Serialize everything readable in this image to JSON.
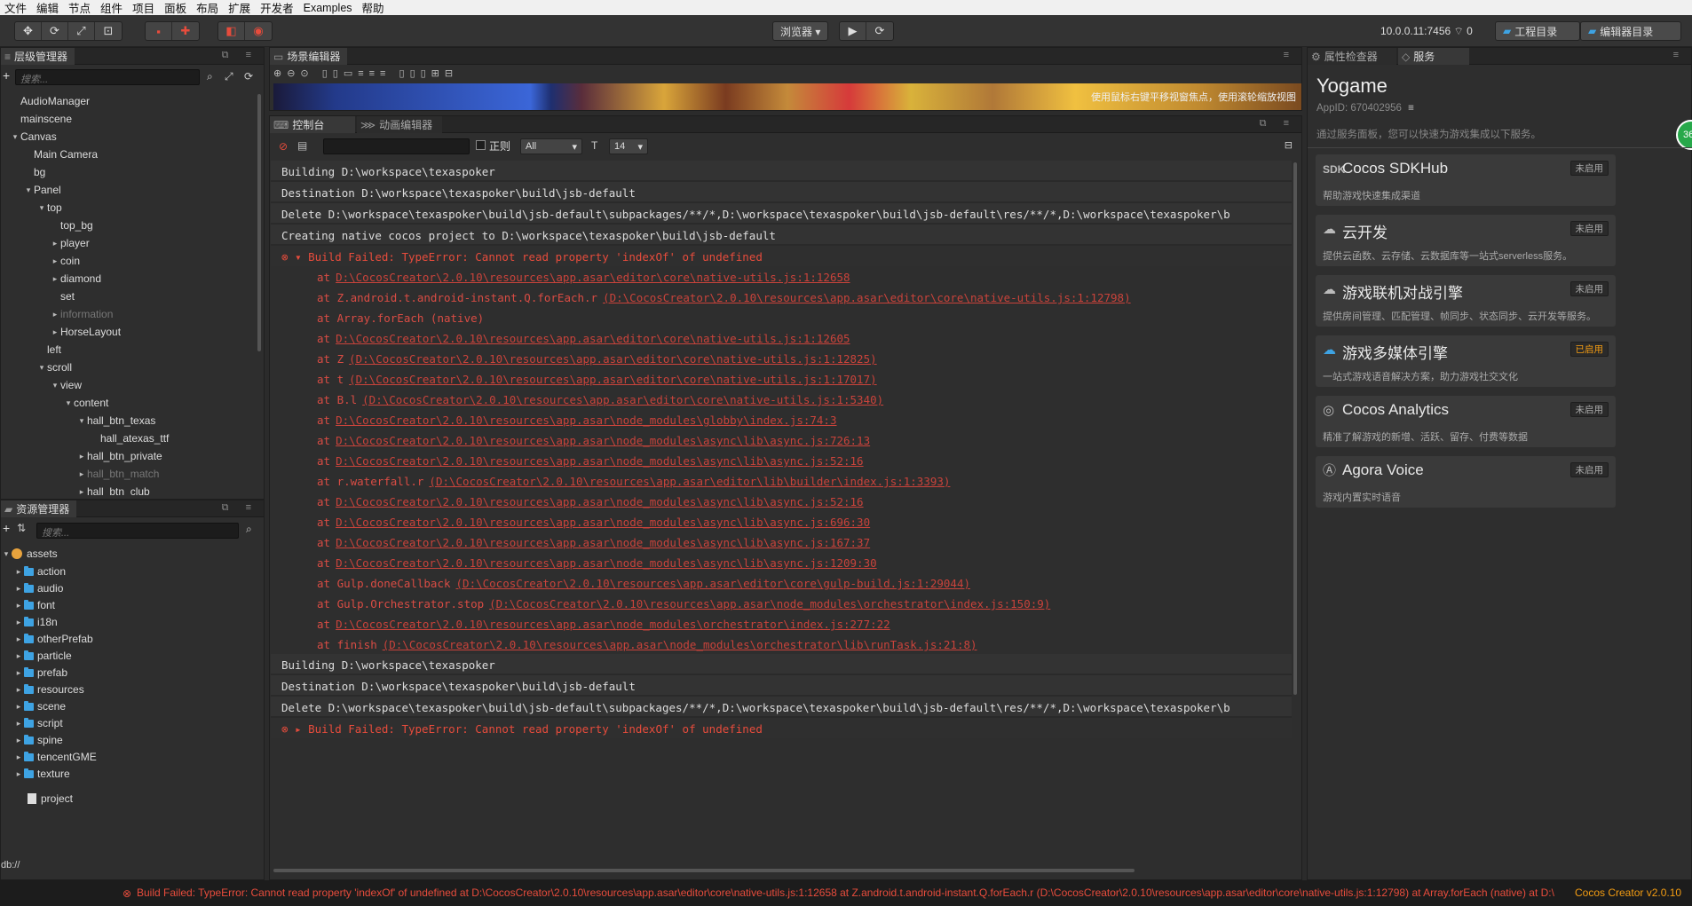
{
  "menubar": {
    "items": [
      "文件",
      "编辑",
      "节点",
      "组件",
      "项目",
      "面板",
      "布局",
      "扩展",
      "开发者",
      "Examples",
      "帮助"
    ]
  },
  "toolbar": {
    "browser_label": "浏览器 ▾",
    "ip": "10.0.0.11:7456",
    "conn_count": "0",
    "project_dir": "工程目录",
    "editor_dir": "编辑器目录"
  },
  "hierarchy": {
    "tab": "层级管理器",
    "search_placeholder": "搜索...",
    "nodes": [
      {
        "label": "AudioManager",
        "indent": 0,
        "arrow": ""
      },
      {
        "label": "mainscene",
        "indent": 0,
        "arrow": ""
      },
      {
        "label": "Canvas",
        "indent": 0,
        "arrow": "▾"
      },
      {
        "label": "Main Camera",
        "indent": 1,
        "arrow": ""
      },
      {
        "label": "bg",
        "indent": 1,
        "arrow": ""
      },
      {
        "label": "Panel",
        "indent": 1,
        "arrow": "▾"
      },
      {
        "label": "top",
        "indent": 2,
        "arrow": "▾"
      },
      {
        "label": "top_bg",
        "indent": 3,
        "arrow": ""
      },
      {
        "label": "player",
        "indent": 3,
        "arrow": "▸"
      },
      {
        "label": "coin",
        "indent": 3,
        "arrow": "▸"
      },
      {
        "label": "diamond",
        "indent": 3,
        "arrow": "▸"
      },
      {
        "label": "set",
        "indent": 3,
        "arrow": ""
      },
      {
        "label": "information",
        "indent": 3,
        "arrow": "▸",
        "dim": true
      },
      {
        "label": "HorseLayout",
        "indent": 3,
        "arrow": "▸"
      },
      {
        "label": "left",
        "indent": 2,
        "arrow": ""
      },
      {
        "label": "scroll",
        "indent": 2,
        "arrow": "▾"
      },
      {
        "label": "view",
        "indent": 3,
        "arrow": "▾"
      },
      {
        "label": "content",
        "indent": 4,
        "arrow": "▾"
      },
      {
        "label": "hall_btn_texas",
        "indent": 5,
        "arrow": "▾"
      },
      {
        "label": "hall_atexas_ttf",
        "indent": 6,
        "arrow": ""
      },
      {
        "label": "hall_btn_private",
        "indent": 5,
        "arrow": "▸"
      },
      {
        "label": "hall_btn_match",
        "indent": 5,
        "arrow": "▸",
        "dim": true
      },
      {
        "label": "hall_btn_club",
        "indent": 5,
        "arrow": "▸"
      }
    ]
  },
  "assets": {
    "tab": "资源管理器",
    "search_placeholder": "搜索...",
    "root": "assets",
    "folders": [
      "action",
      "audio",
      "font",
      "i18n",
      "otherPrefab",
      "particle",
      "prefab",
      "resources",
      "scene",
      "script",
      "spine",
      "tencentGME",
      "texture"
    ],
    "file": "project",
    "footer": "db://"
  },
  "scene": {
    "tab": "场景编辑器",
    "hint": "使用鼠标右键平移视窗焦点，使用滚轮缩放视图"
  },
  "console": {
    "tab_console": "控制台",
    "tab_anim": "动画编辑器",
    "regex_label": "正则",
    "filter_value": "All",
    "font_size": "14",
    "logs": [
      {
        "type": "info",
        "text": "Building D:\\workspace\\texaspoker"
      },
      {
        "type": "info",
        "text": "Destination D:\\workspace\\texaspoker\\build\\jsb-default"
      },
      {
        "type": "info",
        "text": "Delete D:\\workspace\\texaspoker\\build\\jsb-default\\subpackages/**/*,D:\\workspace\\texaspoker\\build\\jsb-default\\res/**/*,D:\\workspace\\texaspoker\\b"
      },
      {
        "type": "info",
        "text": "Creating native cocos project to D:\\workspace\\texaspoker\\build\\jsb-default"
      },
      {
        "type": "err",
        "text": "Build Failed: TypeError: Cannot read property 'indexOf' of undefined",
        "open": true
      },
      {
        "type": "trace",
        "fn": "at",
        "loc": "D:\\CocosCreator\\2.0.10\\resources\\app.asar\\editor\\core\\native-utils.js:1:12658"
      },
      {
        "type": "trace",
        "fn": "at Z.android.t.android-instant.Q.forEach.r",
        "loc": "(D:\\CocosCreator\\2.0.10\\resources\\app.asar\\editor\\core\\native-utils.js:1:12798)"
      },
      {
        "type": "trace",
        "fn": "at Array.forEach (native)",
        "loc": ""
      },
      {
        "type": "trace",
        "fn": "at",
        "loc": "D:\\CocosCreator\\2.0.10\\resources\\app.asar\\editor\\core\\native-utils.js:1:12605"
      },
      {
        "type": "trace",
        "fn": "at Z",
        "loc": "(D:\\CocosCreator\\2.0.10\\resources\\app.asar\\editor\\core\\native-utils.js:1:12825)"
      },
      {
        "type": "trace",
        "fn": "at t",
        "loc": "(D:\\CocosCreator\\2.0.10\\resources\\app.asar\\editor\\core\\native-utils.js:1:17017)"
      },
      {
        "type": "trace",
        "fn": "at B.l",
        "loc": "(D:\\CocosCreator\\2.0.10\\resources\\app.asar\\editor\\core\\native-utils.js:1:5340)"
      },
      {
        "type": "trace",
        "fn": "at",
        "loc": "D:\\CocosCreator\\2.0.10\\resources\\app.asar\\node_modules\\globby\\index.js:74:3"
      },
      {
        "type": "trace",
        "fn": "at",
        "loc": "D:\\CocosCreator\\2.0.10\\resources\\app.asar\\node_modules\\async\\lib\\async.js:726:13"
      },
      {
        "type": "trace",
        "fn": "at",
        "loc": "D:\\CocosCreator\\2.0.10\\resources\\app.asar\\node_modules\\async\\lib\\async.js:52:16"
      },
      {
        "type": "trace",
        "fn": "at r.waterfall.r",
        "loc": "(D:\\CocosCreator\\2.0.10\\resources\\app.asar\\editor\\lib\\builder\\index.js:1:3393)"
      },
      {
        "type": "trace",
        "fn": "at",
        "loc": "D:\\CocosCreator\\2.0.10\\resources\\app.asar\\node_modules\\async\\lib\\async.js:52:16"
      },
      {
        "type": "trace",
        "fn": "at",
        "loc": "D:\\CocosCreator\\2.0.10\\resources\\app.asar\\node_modules\\async\\lib\\async.js:696:30"
      },
      {
        "type": "trace",
        "fn": "at",
        "loc": "D:\\CocosCreator\\2.0.10\\resources\\app.asar\\node_modules\\async\\lib\\async.js:167:37"
      },
      {
        "type": "trace",
        "fn": "at",
        "loc": "D:\\CocosCreator\\2.0.10\\resources\\app.asar\\node_modules\\async\\lib\\async.js:1209:30"
      },
      {
        "type": "trace",
        "fn": "at Gulp.doneCallback",
        "loc": "(D:\\CocosCreator\\2.0.10\\resources\\app.asar\\editor\\core\\gulp-build.js:1:29044)"
      },
      {
        "type": "trace",
        "fn": "at Gulp.Orchestrator.stop",
        "loc": "(D:\\CocosCreator\\2.0.10\\resources\\app.asar\\node_modules\\orchestrator\\index.js:150:9)"
      },
      {
        "type": "trace",
        "fn": "at",
        "loc": "D:\\CocosCreator\\2.0.10\\resources\\app.asar\\node_modules\\orchestrator\\index.js:277:22"
      },
      {
        "type": "trace",
        "fn": "at finish",
        "loc": "(D:\\CocosCreator\\2.0.10\\resources\\app.asar\\node_modules\\orchestrator\\lib\\runTask.js:21:8)"
      },
      {
        "type": "info",
        "text": "Building D:\\workspace\\texaspoker"
      },
      {
        "type": "info",
        "text": "Destination D:\\workspace\\texaspoker\\build\\jsb-default"
      },
      {
        "type": "info",
        "text": "Delete D:\\workspace\\texaspoker\\build\\jsb-default\\subpackages/**/*,D:\\workspace\\texaspoker\\build\\jsb-default\\res/**/*,D:\\workspace\\texaspoker\\b"
      },
      {
        "type": "err",
        "text": "Build Failed: TypeError: Cannot read property 'indexOf' of undefined",
        "open": false
      }
    ]
  },
  "services": {
    "tab_inspector": "属性检查器",
    "tab_services": "服务",
    "title": "Yogame",
    "appid": "AppID: 670402956",
    "intro": "通过服务面板，您可以快速为游戏集成以下服务。",
    "badge_num": "36",
    "cards": [
      {
        "icon": "sdkhub-icon",
        "glyph": "SDK",
        "title": "Cocos SDKHub",
        "desc": "帮助游戏快速集成渠道",
        "status": "未启用",
        "on": false
      },
      {
        "icon": "cloud-icon",
        "glyph": "☁",
        "title": "云开发",
        "desc": "提供云函数、云存储、云数据库等一站式serverless服务。",
        "status": "未启用",
        "on": false
      },
      {
        "icon": "cloud-icon",
        "glyph": "☁",
        "title": "游戏联机对战引擎",
        "desc": "提供房间管理、匹配管理、帧同步、状态同步、云开发等服务。",
        "status": "未启用",
        "on": false
      },
      {
        "icon": "cloud-blue-icon",
        "glyph": "☁",
        "title": "游戏多媒体引擎",
        "desc": "一站式游戏语音解决方案，助力游戏社交文化",
        "status": "已启用",
        "on": true
      },
      {
        "icon": "analytics-icon",
        "glyph": "◎",
        "title": "Cocos Analytics",
        "desc": "精准了解游戏的新增、活跃、留存、付费等数据",
        "status": "未启用",
        "on": false
      },
      {
        "icon": "agora-icon",
        "glyph": "Ⓐ",
        "title": "Agora Voice",
        "desc": "游戏内置实时语音",
        "status": "未启用",
        "on": false
      }
    ]
  },
  "status": {
    "error": "Build Failed: TypeError: Cannot read property 'indexOf' of undefined at D:\\CocosCreator\\2.0.10\\resources\\app.asar\\editor\\core\\native-utils.js:1:12658 at Z.android.t.android-instant.Q.forEach.r (D:\\CocosCreator\\2.0.10\\resources\\app.asar\\editor\\core\\native-utils.js:1:12798) at Array.forEach (native) at D:\\",
    "version": "Cocos Creator v2.0.10"
  },
  "colors": {
    "accent": "#3ea3e3",
    "error": "#e74c3c",
    "enabled": "#f39c12"
  }
}
